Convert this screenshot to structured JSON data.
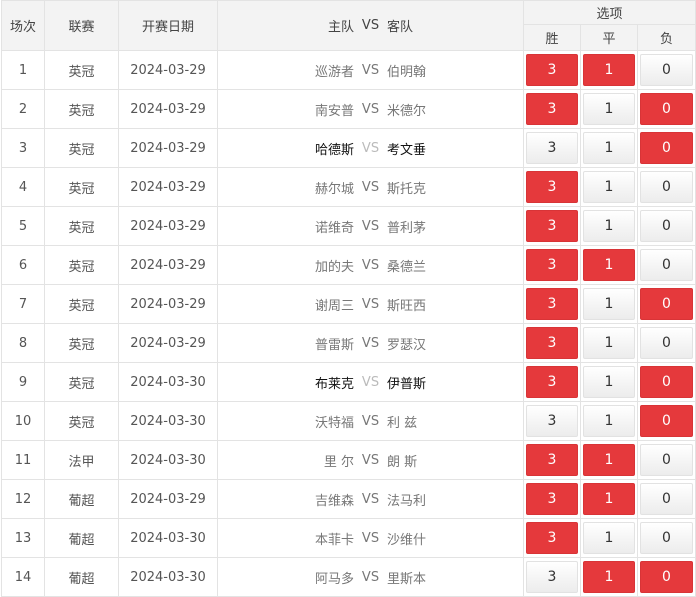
{
  "header": {
    "round": "场次",
    "league": "联赛",
    "date": "开赛日期",
    "home": "主队",
    "vs": "VS",
    "away": "客队",
    "options": "选项",
    "win": "胜",
    "draw": "平",
    "lose": "负"
  },
  "colors": {
    "selected": "#e5393c",
    "header_bg": "#f3f3f3"
  },
  "rows": [
    {
      "no": "1",
      "league": "英冠",
      "date": "2024-03-29",
      "home": "巡游者",
      "vs": "VS",
      "away": "伯明翰",
      "dark": false,
      "win": "3",
      "draw": "1",
      "lose": "0",
      "sel": [
        true,
        true,
        false
      ]
    },
    {
      "no": "2",
      "league": "英冠",
      "date": "2024-03-29",
      "home": "南安普",
      "vs": "VS",
      "away": "米德尔",
      "dark": false,
      "win": "3",
      "draw": "1",
      "lose": "0",
      "sel": [
        true,
        false,
        true
      ]
    },
    {
      "no": "3",
      "league": "英冠",
      "date": "2024-03-29",
      "home": "哈德斯",
      "vs": "VS",
      "away": "考文垂",
      "dark": true,
      "win": "3",
      "draw": "1",
      "lose": "0",
      "sel": [
        false,
        false,
        true
      ]
    },
    {
      "no": "4",
      "league": "英冠",
      "date": "2024-03-29",
      "home": "赫尔城",
      "vs": "VS",
      "away": "斯托克",
      "dark": false,
      "win": "3",
      "draw": "1",
      "lose": "0",
      "sel": [
        true,
        false,
        false
      ]
    },
    {
      "no": "5",
      "league": "英冠",
      "date": "2024-03-29",
      "home": "诺维奇",
      "vs": "VS",
      "away": "普利茅",
      "dark": false,
      "win": "3",
      "draw": "1",
      "lose": "0",
      "sel": [
        true,
        false,
        false
      ]
    },
    {
      "no": "6",
      "league": "英冠",
      "date": "2024-03-29",
      "home": "加的夫",
      "vs": "VS",
      "away": "桑德兰",
      "dark": false,
      "win": "3",
      "draw": "1",
      "lose": "0",
      "sel": [
        true,
        true,
        false
      ]
    },
    {
      "no": "7",
      "league": "英冠",
      "date": "2024-03-29",
      "home": "谢周三",
      "vs": "VS",
      "away": "斯旺西",
      "dark": false,
      "win": "3",
      "draw": "1",
      "lose": "0",
      "sel": [
        true,
        false,
        true
      ]
    },
    {
      "no": "8",
      "league": "英冠",
      "date": "2024-03-29",
      "home": "普雷斯",
      "vs": "VS",
      "away": "罗瑟汉",
      "dark": false,
      "win": "3",
      "draw": "1",
      "lose": "0",
      "sel": [
        true,
        false,
        false
      ]
    },
    {
      "no": "9",
      "league": "英冠",
      "date": "2024-03-30",
      "home": "布莱克",
      "vs": "VS",
      "away": "伊普斯",
      "dark": true,
      "win": "3",
      "draw": "1",
      "lose": "0",
      "sel": [
        true,
        false,
        true
      ]
    },
    {
      "no": "10",
      "league": "英冠",
      "date": "2024-03-30",
      "home": "沃特福",
      "vs": "VS",
      "away": "利 兹",
      "dark": false,
      "win": "3",
      "draw": "1",
      "lose": "0",
      "sel": [
        false,
        false,
        true
      ]
    },
    {
      "no": "11",
      "league": "法甲",
      "date": "2024-03-30",
      "home": "里 尔",
      "vs": "VS",
      "away": "朗 斯",
      "dark": false,
      "win": "3",
      "draw": "1",
      "lose": "0",
      "sel": [
        true,
        true,
        false
      ]
    },
    {
      "no": "12",
      "league": "葡超",
      "date": "2024-03-29",
      "home": "吉维森",
      "vs": "VS",
      "away": "法马利",
      "dark": false,
      "win": "3",
      "draw": "1",
      "lose": "0",
      "sel": [
        true,
        true,
        false
      ]
    },
    {
      "no": "13",
      "league": "葡超",
      "date": "2024-03-30",
      "home": "本菲卡",
      "vs": "VS",
      "away": "沙维什",
      "dark": false,
      "win": "3",
      "draw": "1",
      "lose": "0",
      "sel": [
        true,
        false,
        false
      ]
    },
    {
      "no": "14",
      "league": "葡超",
      "date": "2024-03-30",
      "home": "阿马多",
      "vs": "VS",
      "away": "里斯本",
      "dark": false,
      "win": "3",
      "draw": "1",
      "lose": "0",
      "sel": [
        false,
        true,
        true
      ]
    }
  ]
}
